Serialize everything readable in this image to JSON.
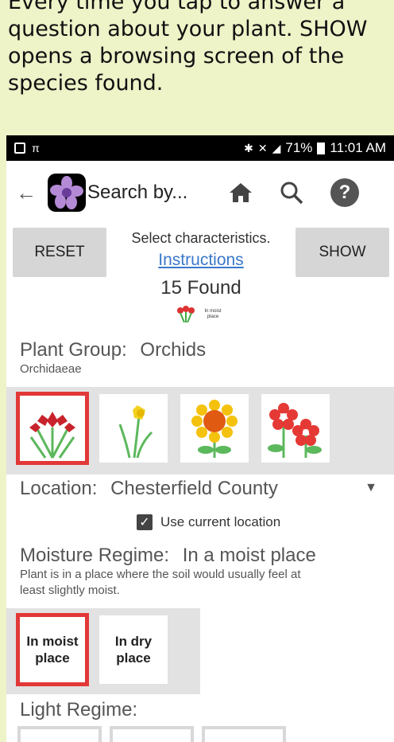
{
  "caption": {
    "line1": "Every time you tap to answer a",
    "line2": "question about your plant. SHOW",
    "line3": "opens a browsing screen of the",
    "line4": "species found."
  },
  "status_bar": {
    "left_icons": [
      "screenshot-icon",
      "nav-icon"
    ],
    "battery_percent": "71%",
    "time": "11:01 AM"
  },
  "app_bar": {
    "title": "Search by...",
    "icons": [
      "back-arrow-icon",
      "app-flower-logo",
      "home-icon",
      "search-icon",
      "help-icon"
    ],
    "help_glyph": "?"
  },
  "controls": {
    "reset_label": "RESET",
    "show_label": "SHOW",
    "select_text": "Select characteristics.",
    "instructions_link": "Instructions",
    "found_text": "15 Found",
    "mini_tag": "In moist place"
  },
  "plant_group": {
    "label": "Plant Group:",
    "value": "Orchids",
    "family": "Orchidaeae",
    "options": [
      "orchid",
      "daffodil",
      "sunflower",
      "red-flowers"
    ],
    "selected": "orchid"
  },
  "location": {
    "label": "Location:",
    "value": "Chesterfield County",
    "use_current_label": "Use current location",
    "use_current_checked": true
  },
  "moisture": {
    "label": "Moisture Regime:",
    "value": "In a moist place",
    "description_line1": "Plant is in a place where the soil would usually feel at",
    "description_line2": "least slightly moist.",
    "opt1_line1": "In moist",
    "opt1_line2": "place",
    "opt2_line1": "In dry",
    "opt2_line2": "place",
    "selected": "In moist place"
  },
  "light": {
    "label": "Light Regime:"
  },
  "colors": {
    "accent_red": "#e23838",
    "link_blue": "#3a78c9",
    "caption_bg": "#eef3c8"
  }
}
